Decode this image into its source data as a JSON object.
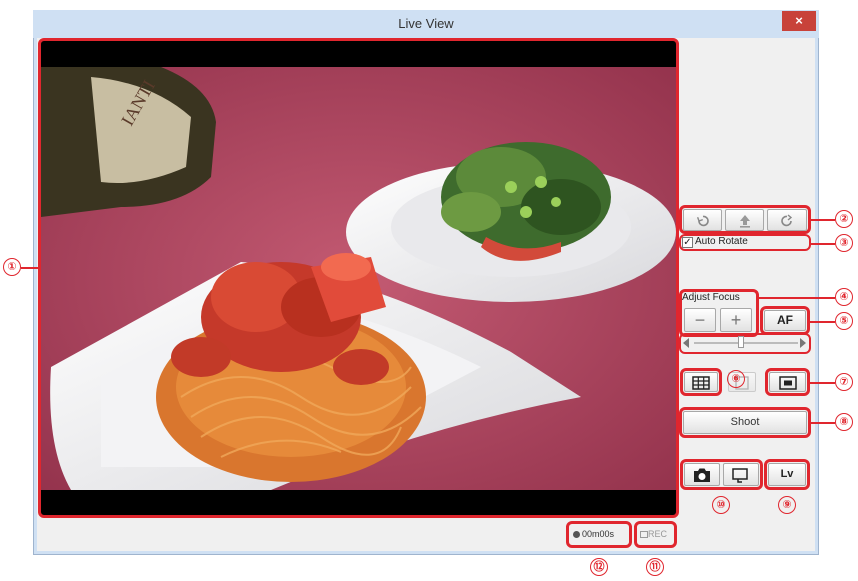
{
  "window": {
    "title": "Live View",
    "close_glyph": "×"
  },
  "rotate_buttons": {
    "left_icon": "rotate-ccw-icon",
    "up_icon": "upload-arrow-icon",
    "right_icon": "rotate-cw-icon"
  },
  "auto_rotate": {
    "label": "Auto Rotate",
    "checked": true
  },
  "adjust_focus": {
    "label": "Adjust Focus",
    "minus": "−",
    "plus": "+",
    "af_label": "AF"
  },
  "shoot": {
    "label": "Shoot"
  },
  "lv": {
    "label": "Lv"
  },
  "status": {
    "timer": "00m00s",
    "rec": "REC"
  },
  "callouts": [
    "①",
    "②",
    "③",
    "④",
    "⑤",
    "⑥",
    "⑦",
    "⑧",
    "⑨",
    "⑩",
    "⑪",
    "⑫"
  ],
  "colors": {
    "accent_red": "#e0262e",
    "window_bg": "#cfe0f3",
    "close_red": "#c8423a"
  }
}
